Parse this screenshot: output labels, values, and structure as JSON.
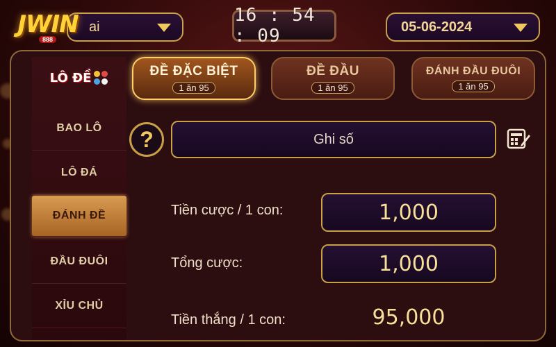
{
  "brand_logo": {
    "text": "JWIN",
    "sub": "888"
  },
  "region_select": {
    "value": "ai"
  },
  "clock": {
    "time": "16 : 54 : 09"
  },
  "date_select": {
    "value": "05-06-2024"
  },
  "panel_brand": {
    "text": "LÔ ĐỀ"
  },
  "sidebar": {
    "items": [
      {
        "label": "BAO LÔ"
      },
      {
        "label": "LÔ ĐÁ"
      },
      {
        "label": "ĐÁNH ĐỀ"
      },
      {
        "label": "ĐẦU ĐUÔI"
      },
      {
        "label": "XỈU CHỦ"
      }
    ],
    "active": "ĐÁNH ĐỀ"
  },
  "tabs": [
    {
      "label": "ĐỀ ĐẶC BIỆT",
      "odds": "1 ăn 95"
    },
    {
      "label": "ĐỀ ĐẦU",
      "odds": "1 ăn 95"
    },
    {
      "label": "ĐÁNH ĐẦU ĐUÔI",
      "odds": "1 ăn 95"
    }
  ],
  "active_tab": "ĐỀ ĐẶC BIỆT",
  "number_input": {
    "placeholder": "Ghi số"
  },
  "help_icon": "question-icon",
  "calc_icon": "calculator-edit-icon",
  "bet": {
    "per_unit_label": "Tiền cược / 1 con:",
    "per_unit_value": "1,000",
    "total_label": "Tổng cược:",
    "total_value": "1,000",
    "win_label": "Tiền thắng / 1 con:",
    "win_value": "95,000"
  },
  "colors": {
    "accent_gold": "#c9a048",
    "panel_bg": "#2c0d10",
    "active_gold": "#d89b52"
  }
}
